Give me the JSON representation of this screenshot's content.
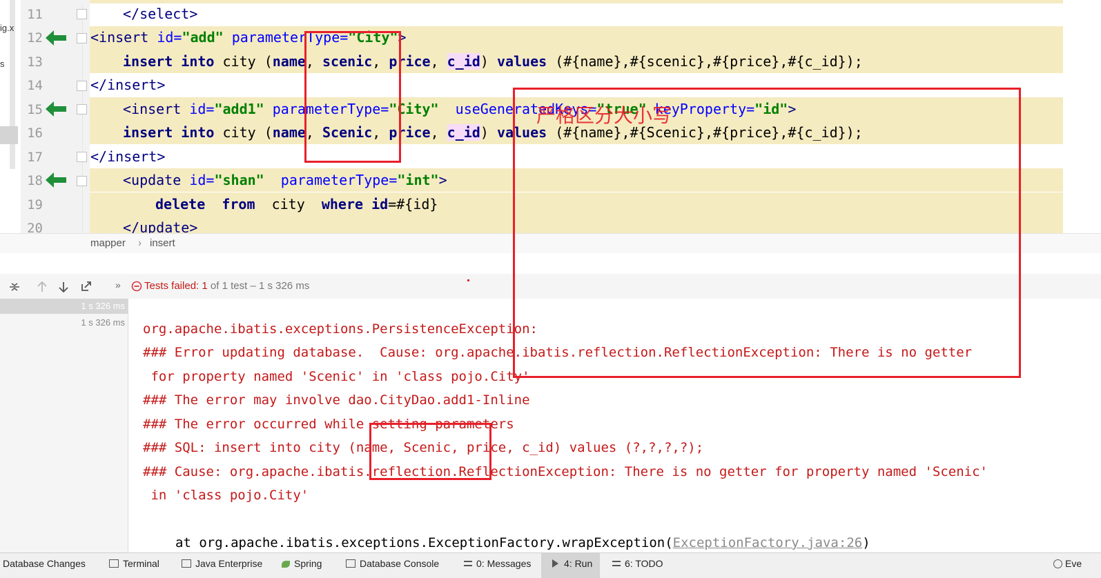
{
  "project_panel": {
    "fragment_1": "ig.x",
    "fragment_2": "s"
  },
  "editor": {
    "lines": [
      {
        "no": "11"
      },
      {
        "no": "12"
      },
      {
        "no": "13"
      },
      {
        "no": "14"
      },
      {
        "no": "15"
      },
      {
        "no": "16"
      },
      {
        "no": "17"
      },
      {
        "no": "18"
      },
      {
        "no": "19"
      },
      {
        "no": "20"
      }
    ]
  },
  "breadcrumb": {
    "item1": "mapper",
    "sep": "›",
    "item2": "insert"
  },
  "annotation": {
    "note": "严格区分大小写"
  },
  "run": {
    "status_label": "Tests failed:",
    "status_count": "1",
    "status_rest": "of 1 test – 1 s 326 ms",
    "tree": {
      "root_time": "1 s 326 ms",
      "child_time": "1 s 326 ms"
    }
  },
  "console": {
    "lines": [
      "org.apache.ibatis.exceptions.PersistenceException:",
      "### Error updating database.  Cause: org.apache.ibatis.reflection.ReflectionException: There is no getter",
      " for property named 'Scenic' in 'class pojo.City'",
      "### The error may involve dao.CityDao.add1-Inline",
      "### The error occurred while setting parameters",
      "### SQL: insert into city (name, Scenic, price, c_id) values (?,?,?,?);",
      "### Cause: org.apache.ibatis.reflection.ReflectionException: There is no getter for property named 'Scenic'",
      " in 'class pojo.City'"
    ],
    "stack_prefix": "at org.apache.ibatis.exceptions.ExceptionFactory.wrapException(",
    "stack_link": "ExceptionFactory.java:26",
    "stack_suffix": ")"
  },
  "statusbar": {
    "items": [
      "Database Changes",
      "Terminal",
      "Java Enterprise",
      "Spring",
      "Database Console",
      "0: Messages",
      "4: Run",
      "6: TODO",
      "Eve"
    ]
  },
  "colors": {
    "highlight": "#f5ebc1",
    "error_text": "#c41919",
    "red_box": "#e8202a",
    "arrow": "#1f8f3a"
  }
}
